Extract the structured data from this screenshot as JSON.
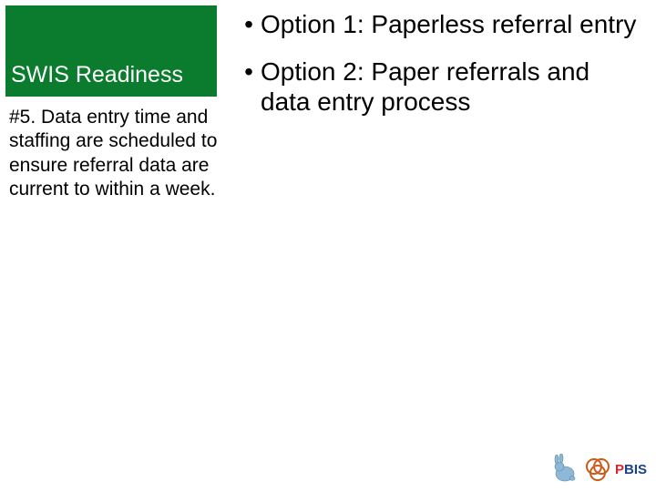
{
  "title": "SWIS Readiness",
  "subtitle": "#5. Data entry time and staffing are scheduled to ensure referral data are current to within a week.",
  "bullets": [
    "Option 1: Paperless referral entry",
    "Option 2: Paper referrals and data entry process"
  ],
  "logo": {
    "letter_p": "P",
    "letters_rest": "BIS"
  },
  "colors": {
    "title_bg": "#0b7b2d",
    "rabbit": "#8fb8d6",
    "rings": "#cc5a1d",
    "pbis_red": "#d9262b",
    "pbis_blue": "#1a428a"
  }
}
